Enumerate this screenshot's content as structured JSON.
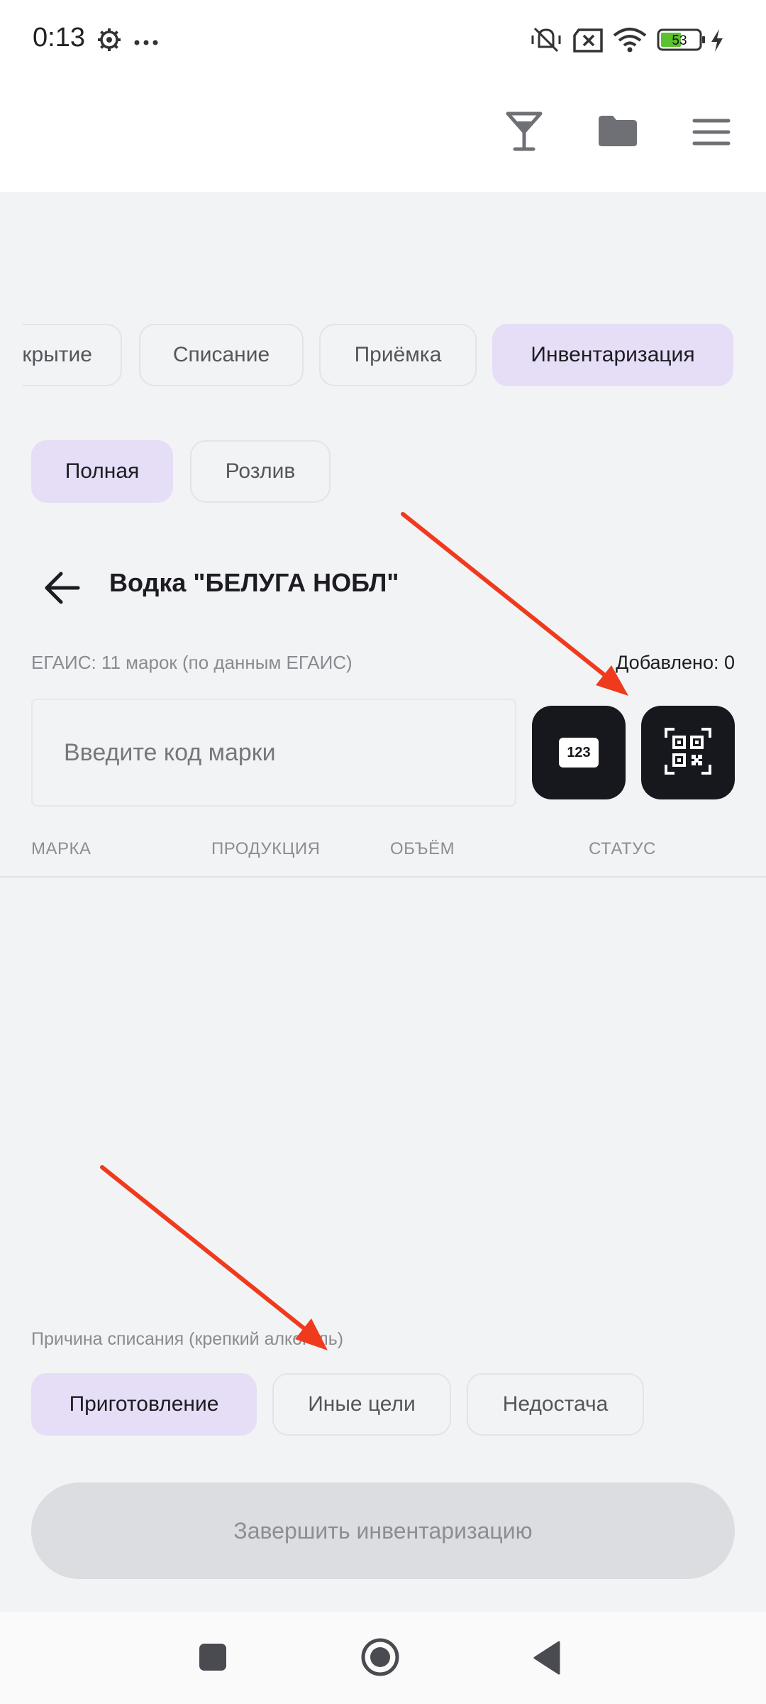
{
  "status_bar": {
    "time": "0:13",
    "battery_level": "53",
    "icons": [
      "gear-icon",
      "more-dots-icon",
      "vibrate-off-icon",
      "sim-error-icon",
      "wifi-icon",
      "battery-icon",
      "charging-icon"
    ]
  },
  "header": {
    "icons": [
      "glass-icon",
      "folder-icon",
      "menu-icon"
    ]
  },
  "tabs": [
    {
      "label": "Открытие",
      "active": false
    },
    {
      "label": "Списание",
      "active": false
    },
    {
      "label": "Приёмка",
      "active": false
    },
    {
      "label": "Инвентаризация",
      "active": true
    }
  ],
  "subtabs": [
    {
      "label": "Полная",
      "active": true
    },
    {
      "label": "Розлив",
      "active": false
    }
  ],
  "page": {
    "title": "Водка \"БЕЛУГА НОБЛ\"",
    "egais_info": "ЕГАИС: 11 марок (по данным ЕГАИС)",
    "added_count": "Добавлено: 0"
  },
  "code_input": {
    "placeholder": "Введите код марки",
    "value": ""
  },
  "buttons": {
    "manual_code_label": "123"
  },
  "table": {
    "columns": [
      "МАРКА",
      "ПРОДУКЦИЯ",
      "ОБЪЁМ",
      "СТАТУС"
    ],
    "rows": []
  },
  "writeoff_reason": {
    "label": "Причина списания (крепкий алкоголь)",
    "options": [
      {
        "label": "Приготовление",
        "active": true
      },
      {
        "label": "Иные цели",
        "active": false
      },
      {
        "label": "Недостача",
        "active": false
      }
    ]
  },
  "finish_button": {
    "label": "Завершить инвентаризацию"
  },
  "colors": {
    "accent_chip": "#e6ddf6",
    "dark_button": "#17181d",
    "annotation_arrow": "#f03a1e",
    "battery_fill": "#5cc130"
  }
}
